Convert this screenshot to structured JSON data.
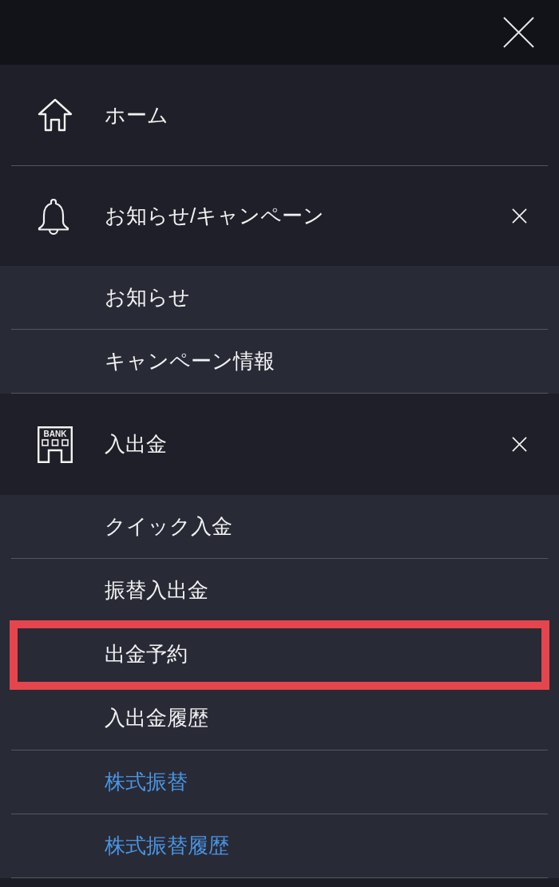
{
  "sections": [
    {
      "label": "ホーム"
    },
    {
      "label": "お知らせ/キャンペーン",
      "expanded": true,
      "items": [
        {
          "label": "お知らせ",
          "kind": "plain",
          "highlighted": false
        },
        {
          "label": "キャンペーン情報",
          "kind": "plain",
          "highlighted": false
        }
      ]
    },
    {
      "label": "入出金",
      "icon_text": "BANK",
      "expanded": true,
      "items": [
        {
          "label": "クイック入金",
          "kind": "plain",
          "highlighted": false
        },
        {
          "label": "振替入出金",
          "kind": "plain",
          "highlighted": false
        },
        {
          "label": "出金予約",
          "kind": "plain",
          "highlighted": true
        },
        {
          "label": "入出金履歴",
          "kind": "plain",
          "highlighted": false
        },
        {
          "label": "株式振替",
          "kind": "link",
          "highlighted": false
        },
        {
          "label": "株式振替履歴",
          "kind": "link",
          "highlighted": false
        }
      ]
    }
  ]
}
